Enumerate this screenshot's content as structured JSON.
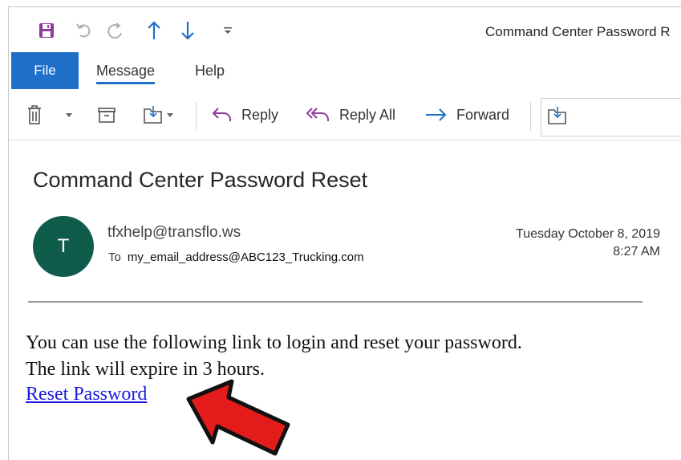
{
  "window": {
    "title": "Command Center Password R"
  },
  "ribbon_tabs": {
    "file": "File",
    "message": "Message",
    "help": "Help"
  },
  "ribbon_actions": {
    "reply": "Reply",
    "reply_all": "Reply All",
    "forward": "Forward"
  },
  "message": {
    "subject": "Command Center Password Reset",
    "avatar_initial": "T",
    "sender": "tfxhelp@transflo.ws",
    "to_label": "To",
    "to_address": "my_email_address@ABC123_Trucking.com",
    "date": "Tuesday October 8, 2019",
    "time": "8:27 AM",
    "body_line1": "You can use the following link to login and reset your password.",
    "body_line2": "The link will expire in 3 hours.",
    "link_text": "Reset Password"
  },
  "colors": {
    "accent": "#1e6fc8",
    "avatar": "#0f5c4a",
    "link": "#1a1adf",
    "arrow": "#e31b1b",
    "save_icon": "#8e3a9a"
  },
  "icons": {
    "save": "save-icon",
    "undo": "undo-icon",
    "redo": "redo-icon",
    "up": "arrow-up-icon",
    "down": "arrow-down-icon",
    "customize": "customize-qat-icon",
    "delete": "trash-icon",
    "archive": "archive-icon",
    "move": "move-to-folder-icon",
    "reply": "reply-icon",
    "reply_all": "reply-all-icon",
    "forward": "forward-icon",
    "annotation": "red-pointer-arrow"
  }
}
